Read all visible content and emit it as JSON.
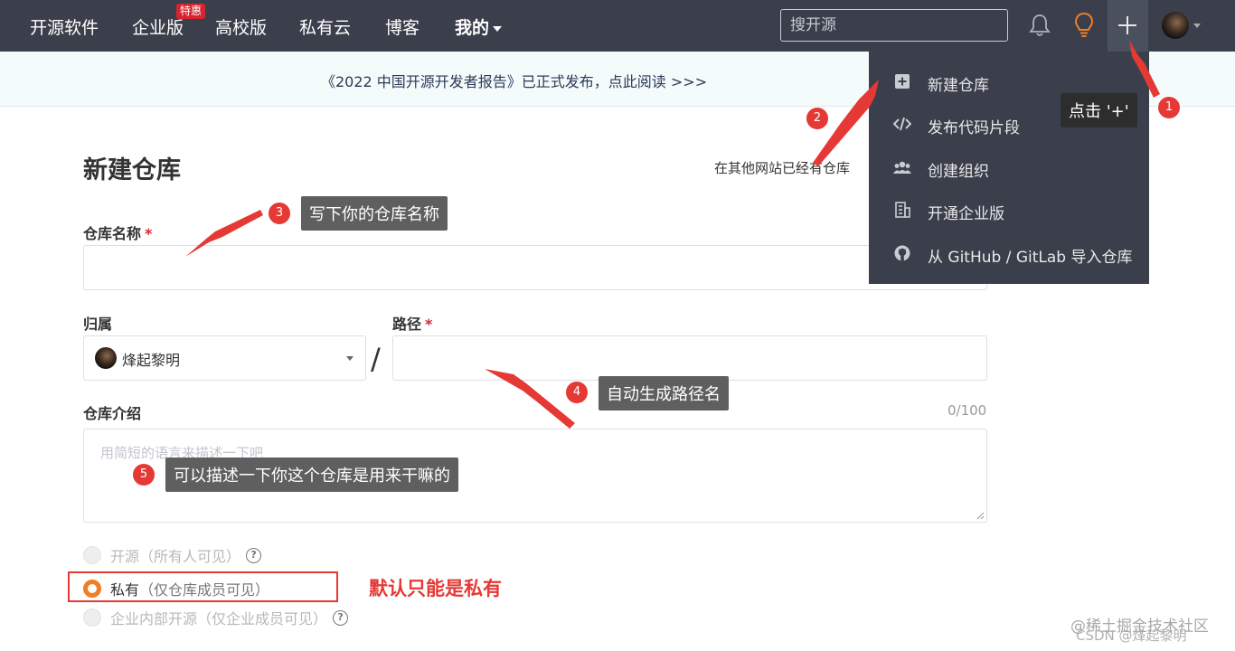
{
  "nav": {
    "items": [
      "开源软件",
      "企业版",
      "高校版",
      "私有云",
      "博客",
      "我的"
    ],
    "badge": "特惠",
    "search_placeholder": "搜开源"
  },
  "banner": {
    "text": "《2022 中国开源开发者报告》已正式发布，点此阅读 >>>"
  },
  "form": {
    "title": "新建仓库",
    "other_site_hint": "在其他网站已经有仓库",
    "repo_name_label": "仓库名称",
    "required_mark": "*",
    "owner_label": "归属",
    "owner_value": "烽起黎明",
    "path_label": "路径",
    "slash": "/",
    "intro_label": "仓库介绍",
    "intro_counter": "0/100",
    "intro_placeholder": "用简短的语言来描述一下吧",
    "visibility": [
      {
        "label": "开源",
        "note": "（所有人可见）",
        "selected": false,
        "help": true
      },
      {
        "label": "私有",
        "note": "（仅仓库成员可见）",
        "selected": true,
        "help": false
      },
      {
        "label": "企业内部开源",
        "note": "（仅企业成员可见）",
        "selected": false,
        "help": true
      }
    ],
    "help_glyph": "?"
  },
  "menu": {
    "items": [
      {
        "label": "新建仓库",
        "icon": "plus-square-icon"
      },
      {
        "label": "发布代码片段",
        "icon": "code-icon"
      },
      {
        "label": "创建组织",
        "icon": "users-icon"
      },
      {
        "label": "开通企业版",
        "icon": "building-icon"
      },
      {
        "label": "从 GitHub / GitLab 导入仓库",
        "icon": "github-icon"
      }
    ]
  },
  "annotations": {
    "tip1": "点击 '+'",
    "tip3": "写下你的仓库名称",
    "tip4": "自动生成路径名",
    "tip5": "可以描述一下你这个仓库是用来干嘛的",
    "note_default": "默认只能是私有",
    "steps": [
      "1",
      "2",
      "3",
      "4",
      "5"
    ]
  },
  "watermark": {
    "line1": "@稀土掘金技术社区",
    "line2": "CSDN @烽起黎明"
  },
  "colors": {
    "nav_bg": "#3b3f4c",
    "accent_orange": "#f27d24",
    "annotation_red": "#e53935"
  }
}
